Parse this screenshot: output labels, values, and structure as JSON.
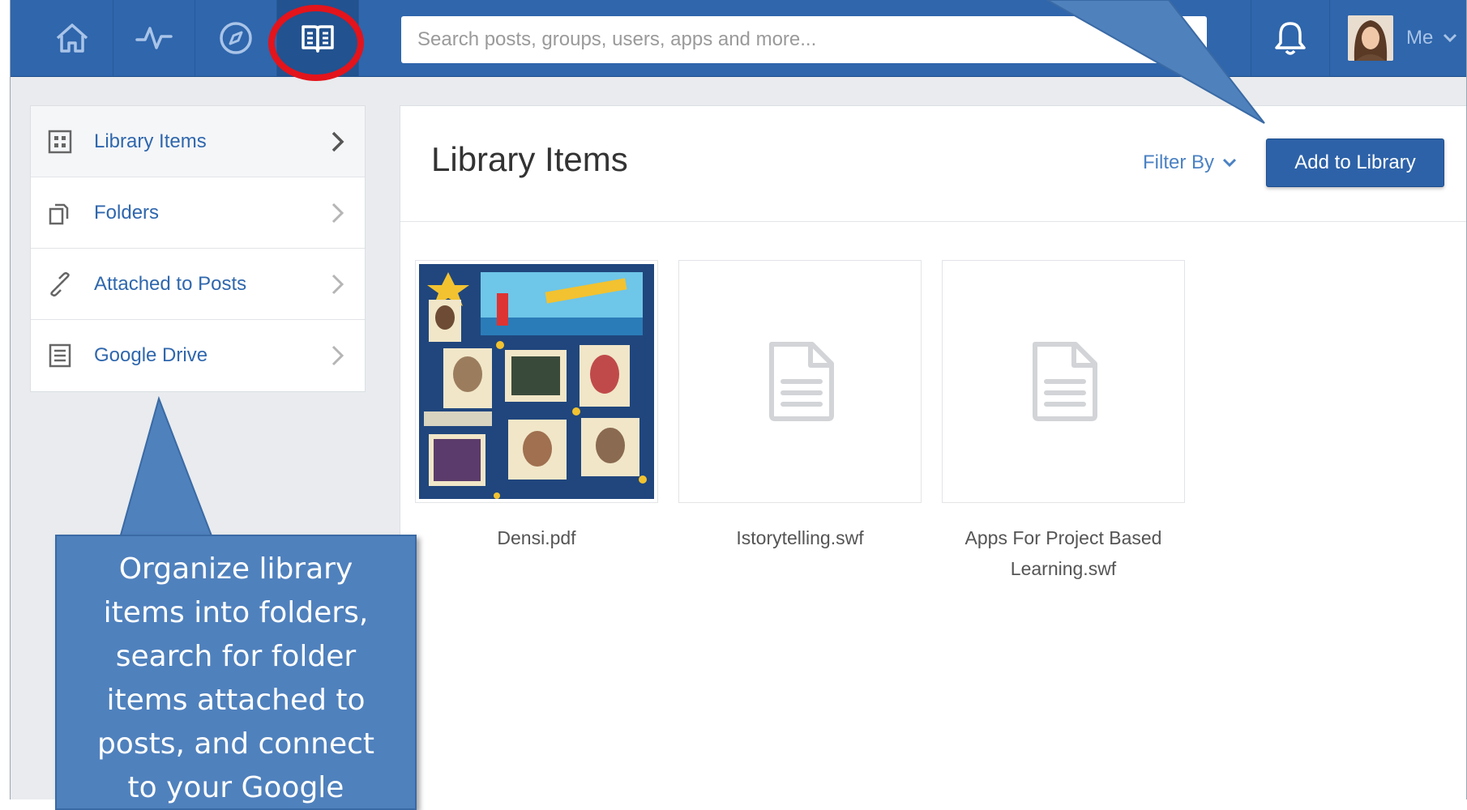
{
  "topbar": {
    "nav": [
      {
        "name": "home",
        "icon": "home-icon"
      },
      {
        "name": "activity",
        "icon": "activity-icon"
      },
      {
        "name": "discover",
        "icon": "compass-icon"
      },
      {
        "name": "library",
        "icon": "book-icon",
        "active": true
      }
    ],
    "search_placeholder": "Search posts, groups, users, apps and more...",
    "notifications_icon": "bell-icon",
    "me_label": "Me"
  },
  "sidebar": {
    "items": [
      {
        "label": "Library Items",
        "icon": "grid-icon",
        "active": true
      },
      {
        "label": "Folders",
        "icon": "folders-icon"
      },
      {
        "label": "Attached to Posts",
        "icon": "link-icon"
      },
      {
        "label": "Google Drive",
        "icon": "drive-doc-icon"
      }
    ]
  },
  "main": {
    "title": "Library Items",
    "filter_label": "Filter By",
    "add_button": "Add to Library",
    "items": [
      {
        "name": "Densi.pdf",
        "thumb": "collage-thumbnail"
      },
      {
        "name": "Istorytelling.swf",
        "thumb": "document-icon"
      },
      {
        "name": "Apps For Project Based Learning.swf",
        "thumb": "document-icon"
      }
    ]
  },
  "callout": {
    "text": "Organize  library items into folders, search for folder items attached to posts, and connect to your Google"
  },
  "colors": {
    "topbar": "#2f66ac",
    "accent": "#2f67ad",
    "callout": "#4f81bd",
    "highlight": "#e3141b"
  }
}
